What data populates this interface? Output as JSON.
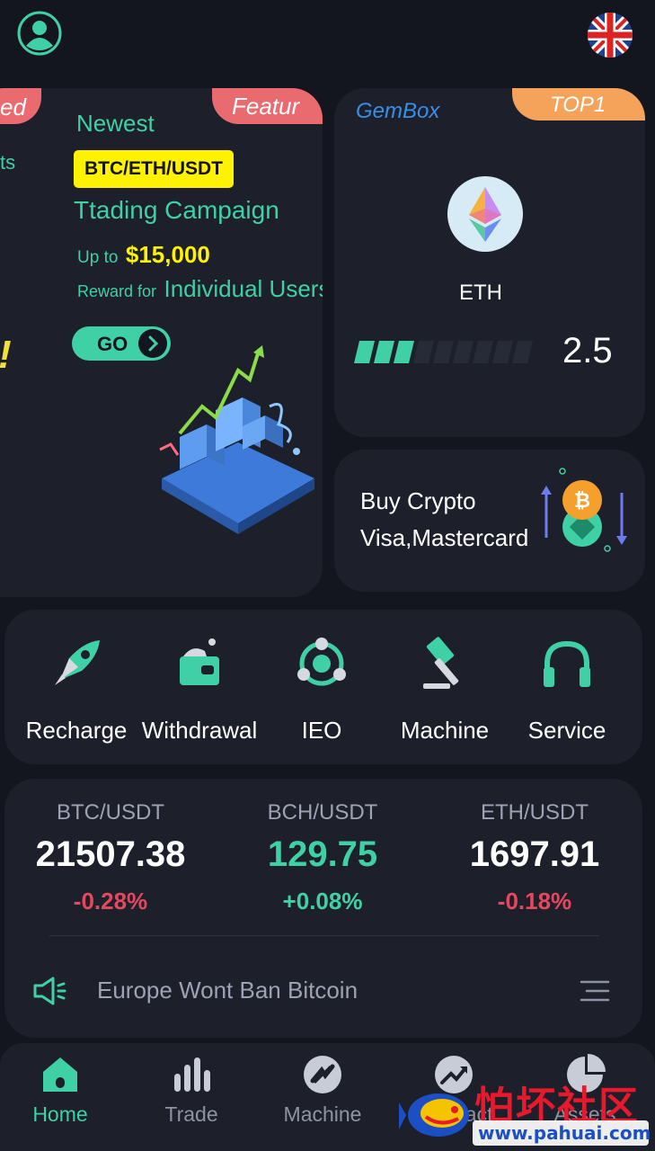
{
  "header": {
    "avatar_icon": "user-avatar-icon",
    "language_flag": "uk-flag-icon"
  },
  "campaign": {
    "left_ribbon": "ed",
    "left_side_text": "ts",
    "left_side_mark": "!",
    "ribbon": "Featur",
    "newest": "Newest",
    "pair_badge": "BTC/ETH/USDT",
    "name": "Ttading Campaign",
    "upto_label": "Up to",
    "amount": "$15,000",
    "reward_label": "Reward for",
    "reward_target": "Individual Users",
    "go_label": "GO"
  },
  "gembox": {
    "brand": "GemBox",
    "rank": "TOP1",
    "coin": "ETH",
    "level_value": "2.5",
    "level_filled_segments": 3,
    "level_total_segments": 9
  },
  "buy_crypto": {
    "title": "Buy Crypto",
    "subtitle": "Visa,Mastercard"
  },
  "actions": [
    {
      "label": "Recharge",
      "icon": "rocket-icon"
    },
    {
      "label": "Withdrawal",
      "icon": "wallet-icon"
    },
    {
      "label": "IEO",
      "icon": "ieo-network-icon"
    },
    {
      "label": "Machine",
      "icon": "hammer-icon"
    },
    {
      "label": "Service",
      "icon": "headphones-icon"
    }
  ],
  "market": {
    "tickers": [
      {
        "pair": "BTC/USDT",
        "price": "21507.38",
        "change": "-0.28%"
      },
      {
        "pair": "BCH/USDT",
        "price": "129.75",
        "change": "+0.08%"
      },
      {
        "pair": "ETH/USDT",
        "price": "1697.91",
        "change": "-0.18%"
      }
    ],
    "news": "Europe Wont Ban Bitcoin"
  },
  "nav": [
    {
      "label": "Home",
      "icon": "home-icon",
      "active": true
    },
    {
      "label": "Trade",
      "icon": "bar-chart-icon",
      "active": false
    },
    {
      "label": "Machine",
      "icon": "machine-icon",
      "active": false
    },
    {
      "label": "Contract",
      "icon": "trend-up-icon",
      "active": false
    },
    {
      "label": "Assets",
      "icon": "pie-chart-icon",
      "active": false
    }
  ],
  "watermark": {
    "title": "怕坏社区",
    "url": "www.pahuai.com"
  },
  "colors": {
    "background": "#14161f",
    "card": "#1d202b",
    "accent_teal": "#3fd0a5",
    "negative": "#e3495e",
    "highlight_yellow": "#fff200",
    "ribbon_red": "#e96a6f",
    "ribbon_orange": "#f5a25a",
    "gembox_blue": "#3a8ee8"
  }
}
